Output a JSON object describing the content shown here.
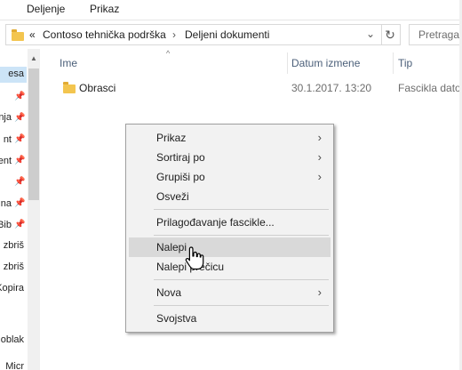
{
  "ribbon": {
    "tabs": [
      "Deljenje",
      "Prikaz"
    ]
  },
  "address_bar": {
    "back_chevron": "«",
    "breadcrumbs": [
      "Contoso tehnička podrška",
      "Deljeni dokumenti"
    ],
    "dropdown_icon": "chevron-down-icon",
    "refresh_icon": "refresh-icon",
    "search_placeholder": "Pretraga u"
  },
  "nav_pane": {
    "items": [
      "esa",
      "nja",
      "nt",
      "ent",
      "na",
      "Bib",
      "zbriš",
      "zbriš",
      "Kopira",
      "oblak",
      "Micr"
    ]
  },
  "columns": {
    "name": "Ime",
    "date": "Datum izmene",
    "type": "Tip"
  },
  "files": [
    {
      "name": "Obrasci",
      "date": "30.1.2017. 13:20",
      "type": "Fascikla datot"
    }
  ],
  "context_menu": {
    "items": [
      {
        "label": "Prikaz",
        "submenu": true
      },
      {
        "label": "Sortiraj po",
        "submenu": true
      },
      {
        "label": "Grupiši po",
        "submenu": true
      },
      {
        "label": "Osveži",
        "submenu": false
      },
      {
        "label": "Prilagođavanje fascikle...",
        "submenu": false
      },
      {
        "label": "Nalepi",
        "submenu": false,
        "highlighted": true
      },
      {
        "label": "Nalepi prečicu",
        "submenu": false
      },
      {
        "label": "Nova",
        "submenu": true
      },
      {
        "label": "Svojstva",
        "submenu": false
      }
    ]
  },
  "colors": {
    "selection": "#cce4f7",
    "menu_hover": "#d9d9d9",
    "folder": "#f3c54f",
    "header_text": "#4c607a"
  }
}
